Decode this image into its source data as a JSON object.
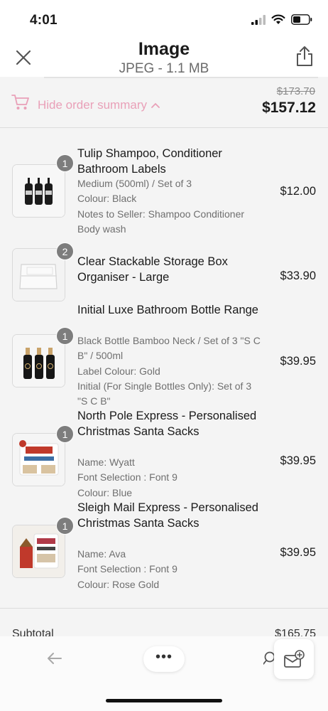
{
  "status_bar": {
    "time": "4:01"
  },
  "nav": {
    "title": "Image",
    "subtitle": "JPEG - 1.1 MB"
  },
  "summary": {
    "hide_label": "Hide order summary",
    "old_total": "$173.70",
    "total": "$157.12"
  },
  "items": [
    {
      "qty": "1",
      "title": "Tulip Shampoo, Conditioner Bathroom Labels",
      "options": [
        "Medium (500ml) / Set of 3",
        "Colour: Black",
        "Notes to Seller: Shampoo Conditioner Body wash"
      ],
      "price": "$12.00"
    },
    {
      "qty": "2",
      "title": "Clear Stackable Storage Box Organiser - Large",
      "options": [],
      "price": "$33.90"
    },
    {
      "qty": "1",
      "title": "Initial Luxe Bathroom Bottle Range",
      "options": [
        "Black Bottle Bamboo Neck / Set of 3 \"S C B\" / 500ml",
        "Label Colour: Gold",
        "Initial (For Single Bottles Only): Set of 3 \"S C B\""
      ],
      "price": "$39.95"
    },
    {
      "qty": "1",
      "title": "North Pole Express - Personalised Christmas Santa Sacks",
      "options": [
        "Name: Wyatt",
        "Font Selection : Font 9",
        "Colour: Blue"
      ],
      "price": "$39.95"
    },
    {
      "qty": "1",
      "title": "Sleigh Mail Express - Personalised Christmas Santa Sacks",
      "options": [
        "Name: Ava",
        "Font Selection : Font 9",
        "Colour: Rose Gold"
      ],
      "price": "$39.95"
    }
  ],
  "subtotal": {
    "label": "Subtotal",
    "value": "$165.75"
  },
  "toolbar": {
    "more_label": "•••"
  },
  "colors": {
    "accent_pink": "#e9a0b8",
    "qty_badge": "#7d7d7d"
  }
}
